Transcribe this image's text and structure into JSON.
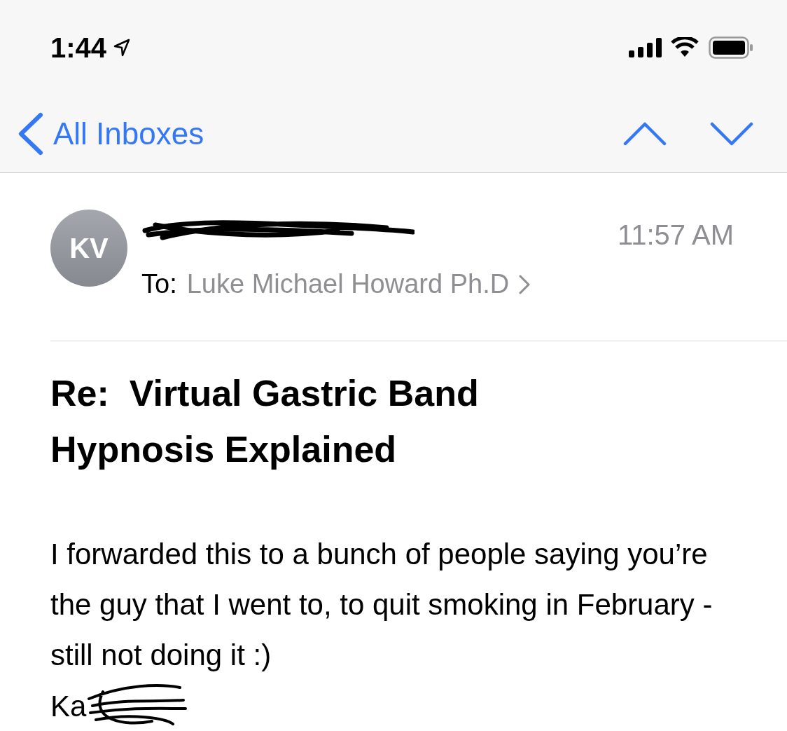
{
  "status_bar": {
    "time": "1:44"
  },
  "nav": {
    "back_label": "All Inboxes"
  },
  "message": {
    "avatar_initials": "KV",
    "time": "11:57 AM",
    "to_label": "To:",
    "recipient": "Luke Michael Howard Ph.D",
    "subject": "Re:  Virtual Gastric Band Hypnosis Explained",
    "body": "I forwarded this to a bunch of people saying you’re the guy that I went to, to quit smoking in February - still not doing it :)",
    "signature": "Ka"
  }
}
